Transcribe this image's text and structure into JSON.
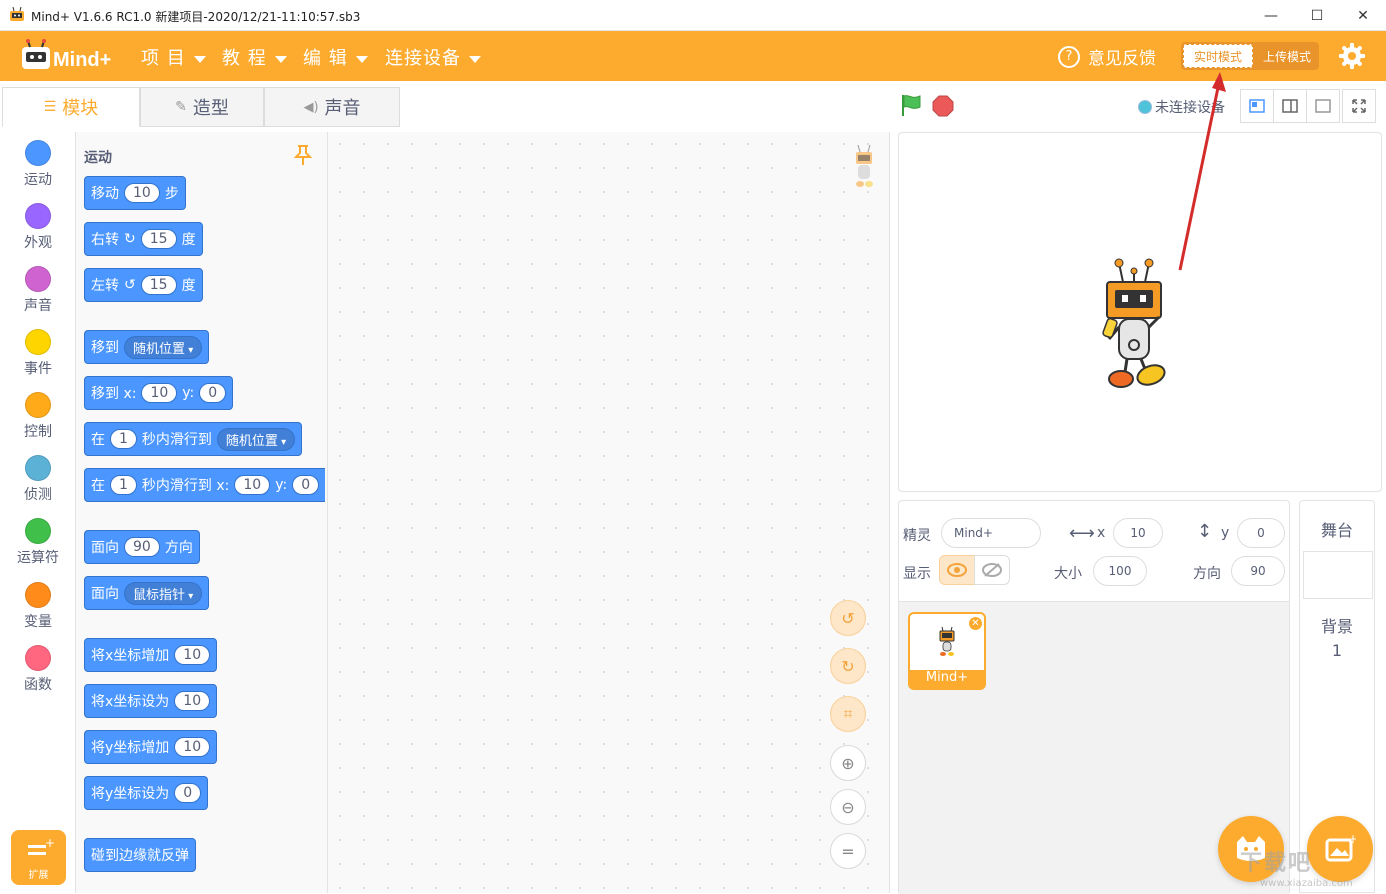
{
  "window": {
    "title": "Mind+ V1.6.6 RC1.0    新建项目-2020/12/21-11:10:57.sb3",
    "minimize": "—",
    "maximize": "☐",
    "close": "✕"
  },
  "menubar": {
    "logo_text": "Mind+",
    "items": [
      {
        "label": "项 目",
        "icon": "chevron-down-icon"
      },
      {
        "label": "教 程",
        "icon": "chevron-down-icon"
      },
      {
        "label": "编 辑",
        "icon": "chevron-down-icon"
      },
      {
        "label": "连接设备",
        "icon": "chevron-down-icon"
      }
    ],
    "feedback": "意见反馈",
    "mode_live": "实时模式",
    "mode_upload": "上传模式",
    "accent": "#fcab2f"
  },
  "tabs": [
    {
      "label": "模块",
      "icon": "blocks-icon",
      "active": true
    },
    {
      "label": "造型",
      "icon": "brush-icon",
      "active": false
    },
    {
      "label": "声音",
      "icon": "speaker-icon",
      "active": false
    }
  ],
  "categories": [
    {
      "label": "运动",
      "color": "#4c97ff"
    },
    {
      "label": "外观",
      "color": "#9966ff"
    },
    {
      "label": "声音",
      "color": "#cf63cf"
    },
    {
      "label": "事件",
      "color": "#ffd500"
    },
    {
      "label": "控制",
      "color": "#ffab19"
    },
    {
      "label": "侦测",
      "color": "#5cb1d6"
    },
    {
      "label": "运算符",
      "color": "#40bf4a"
    },
    {
      "label": "变量",
      "color": "#ff8c1a"
    },
    {
      "label": "函数",
      "color": "#ff6680"
    }
  ],
  "extensions_label": "扩展",
  "palette": {
    "section": "运动",
    "blocks": {
      "move": {
        "a": "移动",
        "v": "10",
        "b": "步"
      },
      "turn_right": {
        "a": "右转",
        "v": "15",
        "b": "度"
      },
      "turn_left": {
        "a": "左转",
        "v": "15",
        "b": "度"
      },
      "goto": {
        "a": "移到",
        "d": "随机位置"
      },
      "goto_xy": {
        "a": "移到 x:",
        "x": "10",
        "b": "y:",
        "y": "0"
      },
      "glide": {
        "a": "在",
        "v": "1",
        "b": "秒内滑行到",
        "d": "随机位置"
      },
      "glide_xy": {
        "a": "在",
        "v": "1",
        "b": "秒内滑行到 x:",
        "x": "10",
        "c": "y:",
        "y": "0"
      },
      "point_dir": {
        "a": "面向",
        "v": "90",
        "b": "方向"
      },
      "point_towards": {
        "a": "面向",
        "d": "鼠标指针"
      },
      "change_x": {
        "a": "将x坐标增加",
        "v": "10"
      },
      "set_x": {
        "a": "将x坐标设为",
        "v": "10"
      },
      "change_y": {
        "a": "将y坐标增加",
        "v": "10"
      },
      "set_y": {
        "a": "将y坐标设为",
        "v": "0"
      },
      "bounce": {
        "a": "碰到边缘就反弹"
      }
    }
  },
  "stage_header": {
    "connection": "未连接设备"
  },
  "sprite_info": {
    "sprite_label": "精灵",
    "sprite_name": "Mind+",
    "x_label": "x",
    "x": "10",
    "y_label": "y",
    "y": "0",
    "show_label": "显示",
    "size_label": "大小",
    "size": "100",
    "direction_label": "方向",
    "direction": "90"
  },
  "sprite_list": [
    {
      "name": "Mind+"
    }
  ],
  "stage_panel": {
    "title": "舞台",
    "backdrop_label": "背景",
    "backdrop_count": "1"
  },
  "watermark": {
    "text": "下载吧",
    "sub": "www.xiazaiba.com"
  }
}
